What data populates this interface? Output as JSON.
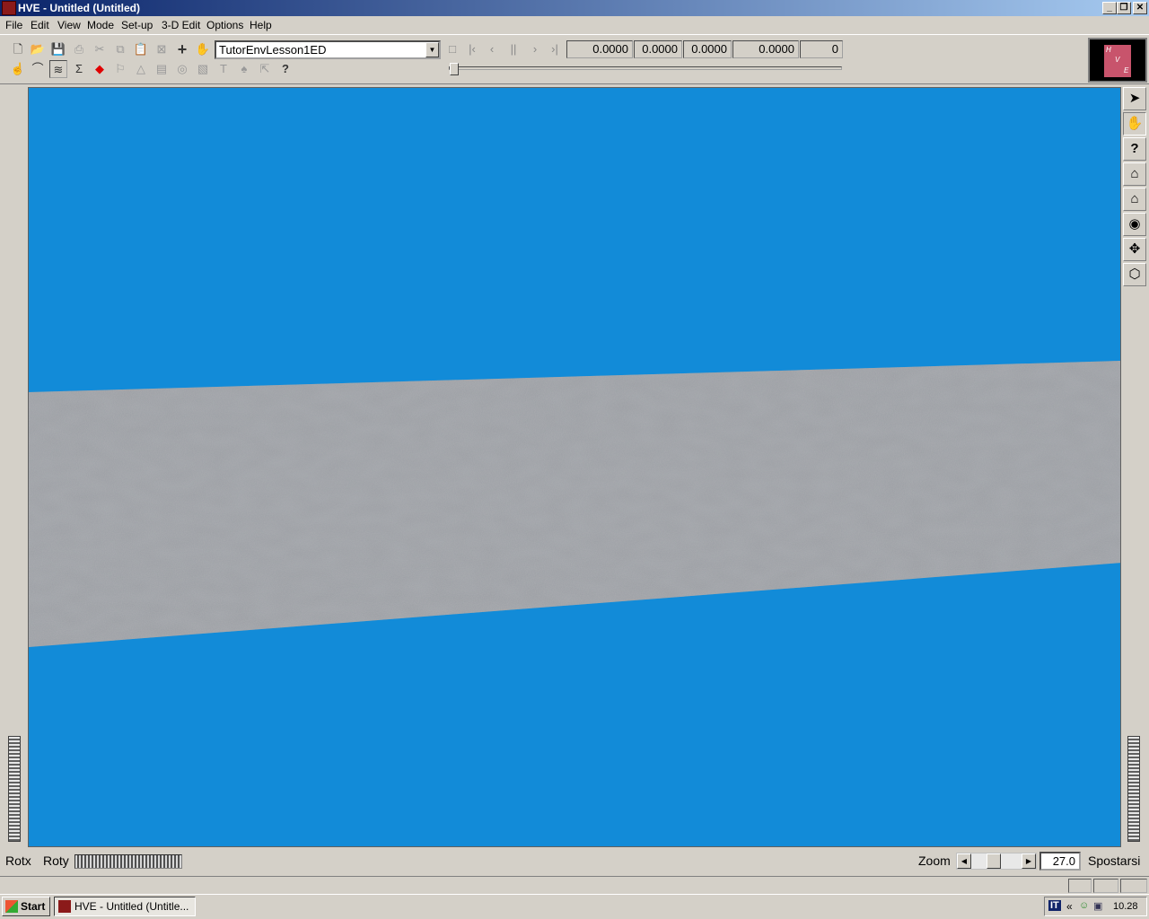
{
  "window": {
    "title": "HVE - Untitled (Untitled)"
  },
  "menu": [
    "File",
    "Edit",
    "View",
    "Mode",
    "Set-up",
    "3-D Edit",
    "Options",
    "Help"
  ],
  "toolbar": {
    "scene_name": "TutorEnvLesson1ED",
    "readouts": [
      "0.0000",
      "0.0000",
      "0.0000",
      "0.0000",
      "0"
    ]
  },
  "logo": {
    "letters": [
      "H",
      "V",
      "E"
    ]
  },
  "right_tools": [
    "select-arrow",
    "hand-pan",
    "help",
    "home",
    "home-set",
    "view-eye",
    "move-crosshair",
    "perspective-cube"
  ],
  "bottom": {
    "rotx_label": "Rotx",
    "roty_label": "Roty",
    "zoom_label": "Zoom",
    "zoom_value": "27.0",
    "spostarsi_label": "Spostarsi"
  },
  "taskbar": {
    "start_label": "Start",
    "task_label": "HVE - Untitled (Untitle...",
    "lang": "IT",
    "chevron": "«",
    "clock": "10.28"
  }
}
